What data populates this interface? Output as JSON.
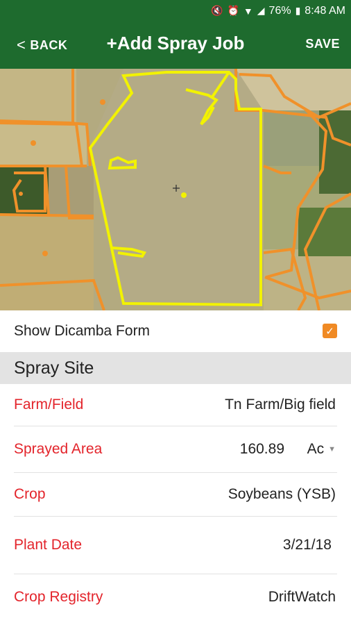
{
  "status_bar": {
    "battery": "76%",
    "time": "8:48 AM"
  },
  "app_bar": {
    "back_label": "BACK",
    "title": "+Add Spray Job",
    "save_label": "SAVE"
  },
  "dicamba": {
    "label": "Show Dicamba Form",
    "checked": true
  },
  "spray_site": {
    "header": "Spray Site",
    "farm_field": {
      "label": "Farm/Field",
      "value": "Tn Farm/Big field"
    },
    "sprayed_area": {
      "label": "Sprayed Area",
      "value": "160.89",
      "unit": "Ac"
    },
    "crop": {
      "label": "Crop",
      "value": "Soybeans (YSB)"
    },
    "plant_date": {
      "label": "Plant Date",
      "value": "3/21/18"
    },
    "crop_registry": {
      "label": "Crop Registry",
      "value": "DriftWatch"
    }
  },
  "colors": {
    "header_green": "#1e6b2e",
    "accent_orange": "#f08a24",
    "field_yellow": "#f2f200",
    "label_red": "#e3242b"
  }
}
